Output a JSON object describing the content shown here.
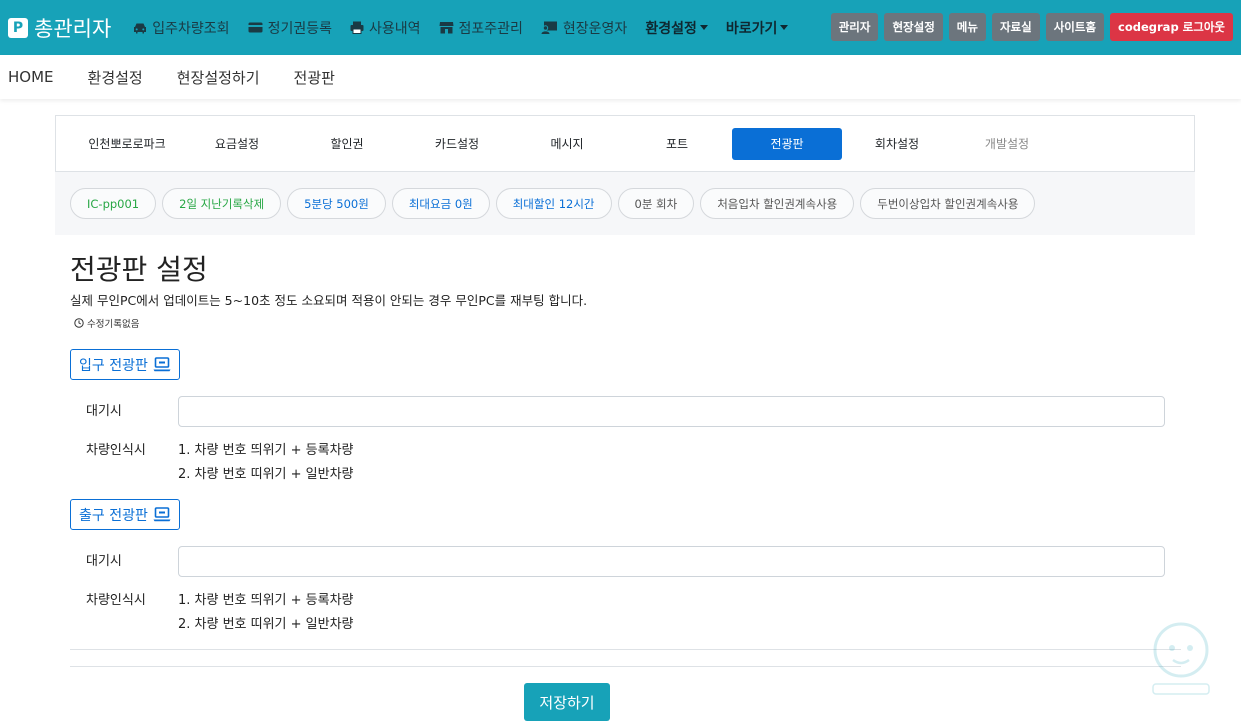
{
  "brand": {
    "logo_letter": "P",
    "title": "총관리자"
  },
  "top_nav": {
    "items": [
      {
        "label": "입주차량조회",
        "icon": "car-icon"
      },
      {
        "label": "정기권등록",
        "icon": "card-icon"
      },
      {
        "label": "사용내역",
        "icon": "print-icon"
      },
      {
        "label": "점포주관리",
        "icon": "store-icon"
      },
      {
        "label": "현장운영자",
        "icon": "operator-icon"
      }
    ],
    "dropdowns": [
      "환경설정",
      "바로가기"
    ],
    "buttons": [
      "관리자",
      "현장설정",
      "메뉴",
      "자료실",
      "사이트홈"
    ],
    "logout": "codegrap 로그아웃"
  },
  "sub_nav": [
    "HOME",
    "환경설정",
    "현장설정하기",
    "전광판"
  ],
  "tabs": [
    {
      "label": "인천뽀로로파크",
      "state": "normal"
    },
    {
      "label": "요금설정",
      "state": "normal"
    },
    {
      "label": "할인권",
      "state": "normal"
    },
    {
      "label": "카드설정",
      "state": "normal"
    },
    {
      "label": "메시지",
      "state": "normal"
    },
    {
      "label": "포트",
      "state": "normal"
    },
    {
      "label": "전광판",
      "state": "active"
    },
    {
      "label": "회차설정",
      "state": "normal"
    },
    {
      "label": "개발설정",
      "state": "muted"
    }
  ],
  "pills": [
    {
      "label": "IC-pp001",
      "color": "green"
    },
    {
      "label": "2일 지난기록삭제",
      "color": "green"
    },
    {
      "label": "5분당 500원",
      "color": "blue"
    },
    {
      "label": "최대요금 0원",
      "color": "blue"
    },
    {
      "label": "최대할인 12시간",
      "color": "blue"
    },
    {
      "label": "0분 회차",
      "color": "gray"
    },
    {
      "label": "처음입차 할인권계속사용",
      "color": "gray"
    },
    {
      "label": "두번이상입차 할인권계속사용",
      "color": "gray"
    }
  ],
  "page": {
    "title": "전광판 설정",
    "description": "실제 무인PC에서 업데이트는 5~10초 정도 소요되며 적용이 안되는 경우 무인PC를 재부팅 합니다.",
    "history": "수정기록없음"
  },
  "entry": {
    "section_label": "입구 전광판",
    "waiting_label": "대기시",
    "waiting_value": "",
    "recognition_label": "차량인식시",
    "lines": [
      "1. 차량 번호 띄위기 + 등록차량",
      "2. 차량 번호 띠위기 + 일반차량"
    ]
  },
  "exit": {
    "section_label": "출구 전광판",
    "waiting_label": "대기시",
    "waiting_value": "",
    "recognition_label": "차량인식시",
    "lines": [
      "1. 차량 번호 띄위기 + 등록차량",
      "2. 차량 번호 띠위기 + 일반차량"
    ]
  },
  "save_label": "저장하기",
  "colors": {
    "primary_teal": "#17a2b8",
    "active_blue": "#0a6fd6",
    "danger": "#dc3545",
    "gray_button": "#6c757d"
  }
}
